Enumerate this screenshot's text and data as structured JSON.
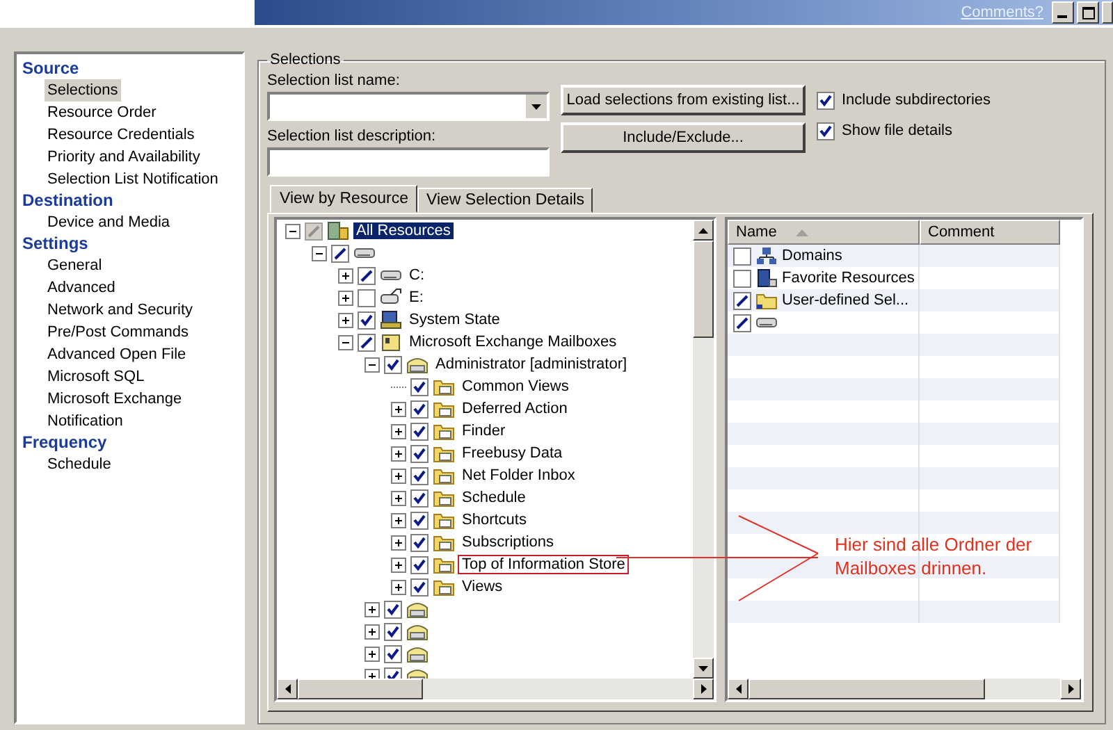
{
  "title_bar": {
    "link": "Comments?"
  },
  "nav": [
    {
      "heading": "Source",
      "items": [
        {
          "label": "Selections",
          "selected": true
        },
        {
          "label": "Resource Order",
          "selected": false
        },
        {
          "label": "Resource Credentials",
          "selected": false
        },
        {
          "label": "Priority and Availability",
          "selected": false
        },
        {
          "label": "Selection List Notification",
          "selected": false
        }
      ]
    },
    {
      "heading": "Destination",
      "items": [
        {
          "label": "Device and Media",
          "selected": false
        }
      ]
    },
    {
      "heading": "Settings",
      "items": [
        {
          "label": "General",
          "selected": false
        },
        {
          "label": "Advanced",
          "selected": false
        },
        {
          "label": "Network and Security",
          "selected": false
        },
        {
          "label": "Pre/Post Commands",
          "selected": false
        },
        {
          "label": "Advanced Open File",
          "selected": false
        },
        {
          "label": "Microsoft SQL",
          "selected": false
        },
        {
          "label": "Microsoft Exchange",
          "selected": false
        },
        {
          "label": "Notification",
          "selected": false
        }
      ]
    },
    {
      "heading": "Frequency",
      "items": [
        {
          "label": "Schedule",
          "selected": false
        }
      ]
    }
  ],
  "selections": {
    "title": "Selections",
    "name_label": "Selection list name:",
    "description_label": "Selection list description:",
    "buttons": [
      "Load selections from existing list...",
      "Include/Exclude..."
    ],
    "options": [
      {
        "label": "Include subdirectories",
        "checked": true
      },
      {
        "label": "Show file details",
        "checked": true
      }
    ],
    "tabs": [
      {
        "label": "View by Resource",
        "selected": true
      },
      {
        "label": "View Selection Details",
        "selected": false
      }
    ],
    "tree": [
      {
        "label": "All Resources",
        "kind": "resources",
        "checked": true,
        "partial": true,
        "disabled": true,
        "expanded": true,
        "selected": true,
        "children": [
          {
            "kind": "drive",
            "checked": true,
            "partial": true,
            "disabled": false,
            "expanded": true,
            "selected": false,
            "children": [
              {
                "label": "C:",
                "kind": "drive",
                "checked": true,
                "partial": true,
                "disabled": false,
                "expanded": false,
                "selected": false
              },
              {
                "label": "E:",
                "kind": "network-drive",
                "checked": false,
                "partial": false,
                "disabled": false,
                "expanded": false,
                "selected": false
              },
              {
                "label": "System State",
                "kind": "system-state",
                "checked": true,
                "partial": false,
                "disabled": false,
                "expanded": false,
                "selected": false
              },
              {
                "label": "Microsoft Exchange Mailboxes",
                "kind": "mailbox-store",
                "checked": true,
                "partial": true,
                "disabled": false,
                "expanded": true,
                "selected": false,
                "children": [
                  {
                    "label": "Administrator [administrator]",
                    "kind": "mailbox",
                    "checked": true,
                    "partial": false,
                    "disabled": false,
                    "expanded": true,
                    "selected": false,
                    "children": [
                      {
                        "label": "Common Views",
                        "kind": "mail-folder",
                        "checked": true,
                        "partial": false,
                        "disabled": false,
                        "leaf": true,
                        "selected": false
                      },
                      {
                        "label": "Deferred Action",
                        "kind": "mail-folder",
                        "checked": true,
                        "partial": false,
                        "disabled": false,
                        "expanded": false,
                        "selected": false
                      },
                      {
                        "label": "Finder",
                        "kind": "mail-folder",
                        "checked": true,
                        "partial": false,
                        "disabled": false,
                        "expanded": false,
                        "selected": false
                      },
                      {
                        "label": "Freebusy Data",
                        "kind": "mail-folder",
                        "checked": true,
                        "partial": false,
                        "disabled": false,
                        "expanded": false,
                        "selected": false
                      },
                      {
                        "label": "Net Folder Inbox",
                        "kind": "mail-folder",
                        "checked": true,
                        "partial": false,
                        "disabled": false,
                        "expanded": false,
                        "selected": false
                      },
                      {
                        "label": "Schedule",
                        "kind": "mail-folder",
                        "checked": true,
                        "partial": false,
                        "disabled": false,
                        "expanded": false,
                        "selected": false
                      },
                      {
                        "label": "Shortcuts",
                        "kind": "mail-folder",
                        "checked": true,
                        "partial": false,
                        "disabled": false,
                        "expanded": false,
                        "selected": false
                      },
                      {
                        "label": "Subscriptions",
                        "kind": "mail-folder",
                        "checked": true,
                        "partial": false,
                        "disabled": false,
                        "expanded": false,
                        "selected": false
                      },
                      {
                        "label": "Top of Information Store",
                        "kind": "mail-folder",
                        "checked": true,
                        "partial": false,
                        "disabled": false,
                        "expanded": false,
                        "selected": false,
                        "highlighted": true
                      },
                      {
                        "label": "Views",
                        "kind": "mail-folder",
                        "checked": true,
                        "partial": false,
                        "disabled": false,
                        "expanded": false,
                        "selected": false
                      }
                    ]
                  },
                  {
                    "kind": "mailbox",
                    "checked": true,
                    "partial": false,
                    "disabled": false,
                    "expanded": false,
                    "selected": false
                  },
                  {
                    "kind": "mailbox",
                    "checked": true,
                    "partial": false,
                    "disabled": false,
                    "expanded": false,
                    "selected": false
                  },
                  {
                    "kind": "mailbox",
                    "checked": true,
                    "partial": false,
                    "disabled": false,
                    "expanded": false,
                    "selected": false
                  },
                  {
                    "kind": "mailbox",
                    "checked": true,
                    "partial": false,
                    "disabled": false,
                    "expanded": false,
                    "selected": false
                  }
                ]
              }
            ]
          }
        ]
      }
    ],
    "list": {
      "columns": [
        "Name",
        "Comment"
      ],
      "rows": [
        {
          "name": "Domains",
          "kind": "domains",
          "checked": false,
          "partial": false
        },
        {
          "name": "Favorite Resources",
          "kind": "favorites",
          "checked": false,
          "partial": false
        },
        {
          "name": "User-defined Sel...",
          "kind": "user-folder",
          "checked": true,
          "partial": true
        },
        {
          "kind": "drive",
          "checked": true,
          "partial": true
        }
      ]
    }
  },
  "annotation": {
    "text": "Hier sind alle Ordner der Mailboxes drinnen."
  }
}
